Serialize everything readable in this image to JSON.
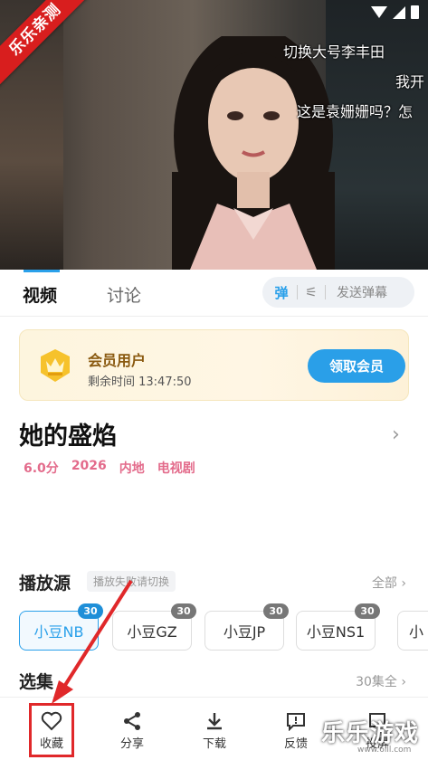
{
  "video": {
    "ribbon": "乐乐亲测",
    "danmu": [
      "切换大号李丰田",
      "我开",
      "这是袁姗姗吗？怎"
    ]
  },
  "tabs": {
    "video": "视频",
    "discuss": "讨论"
  },
  "danmu_bar": {
    "toggle": "弹",
    "send": "发送弹幕"
  },
  "vip": {
    "title": "会员用户",
    "remaining": "剩余时间 13:47:50",
    "button": "领取会员"
  },
  "show": {
    "title": "她的盛焰",
    "rating": "6.0分",
    "year": "2026",
    "region": "内地",
    "category": "电视剧"
  },
  "source": {
    "title": "播放源",
    "hint": "播放失败请切换",
    "all": "全部",
    "chips": [
      {
        "label": "小豆NB",
        "count": "30"
      },
      {
        "label": "小豆GZ",
        "count": "30"
      },
      {
        "label": "小豆JP",
        "count": "30"
      },
      {
        "label": "小豆NS1",
        "count": "30"
      },
      {
        "label": "小",
        "count": ""
      }
    ]
  },
  "episodes": {
    "title": "选集",
    "all": "30集全"
  },
  "bottom": {
    "favorite": "收藏",
    "share": "分享",
    "download": "下载",
    "feedback": "反馈",
    "more": "投屏"
  },
  "watermark": {
    "text": "乐乐游戏",
    "url": "www.6lll.com"
  },
  "colors": {
    "accent": "#2aa0ea",
    "pink": "#e36b8b",
    "highlight_box": "#e0282a",
    "ribbon": "#d81e1e"
  }
}
